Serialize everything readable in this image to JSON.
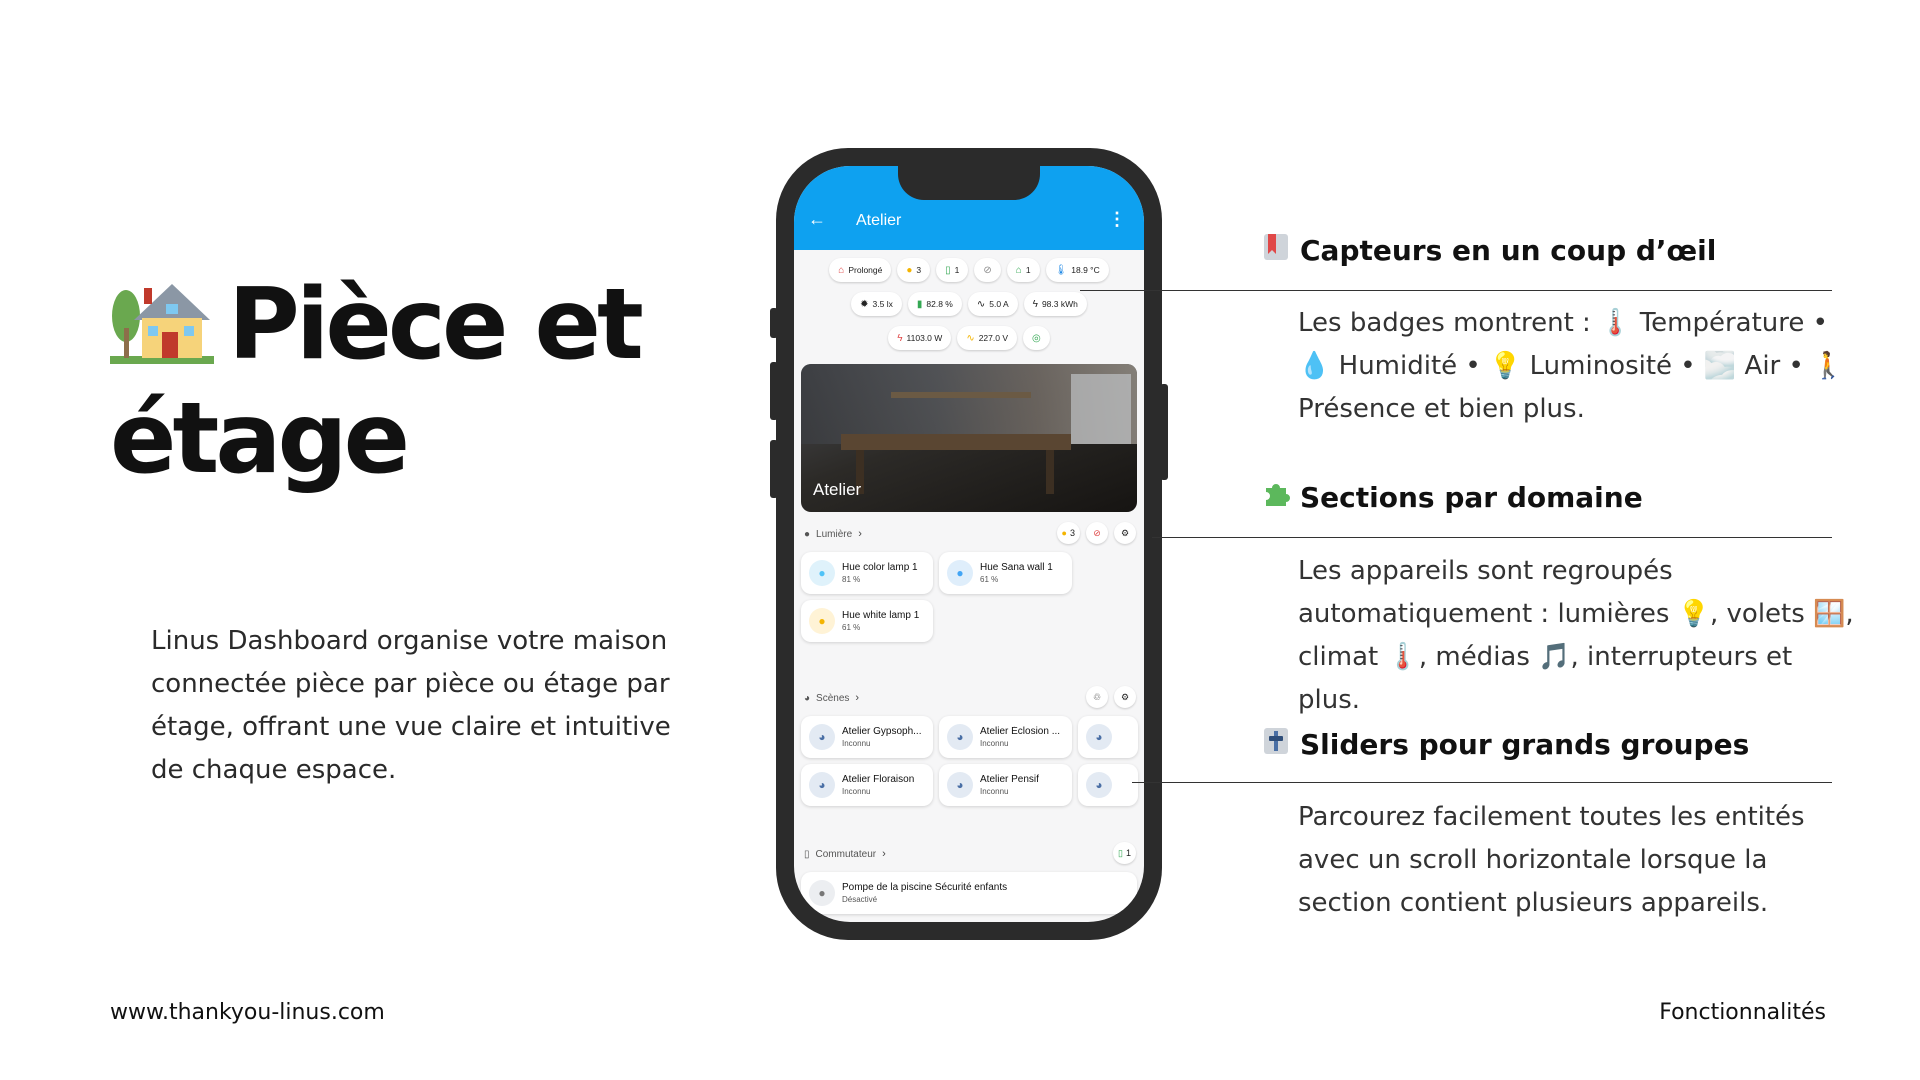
{
  "slide": {
    "title_line1": "Pièce et",
    "title_line2": "étage",
    "intro": "Linus Dashboard organise votre maison connectée pièce par pièce ou étage par étage, offrant une vue claire et intuitive de chaque espace.",
    "footer_left": "www.thankyou-linus.com",
    "footer_right": "Fonctionnalités"
  },
  "phone": {
    "app_title": "Atelier",
    "badges_row1": [
      {
        "icon": "home-icon",
        "label": "Prolongé"
      },
      {
        "icon": "bulb-icon",
        "label": "3"
      },
      {
        "icon": "switch-icon",
        "label": "1"
      },
      {
        "icon": "sensor-off-icon",
        "label": ""
      },
      {
        "icon": "home-green-icon",
        "label": "1"
      },
      {
        "icon": "thermometer-icon",
        "label": "18.9 °C"
      }
    ],
    "badges_row2": [
      {
        "icon": "lux-icon",
        "label": "3.5 lx"
      },
      {
        "icon": "battery-icon",
        "label": "82.8 %"
      },
      {
        "icon": "current-icon",
        "label": "5.0 A"
      },
      {
        "icon": "energy-icon",
        "label": "98.3 kWh"
      }
    ],
    "badges_row3": [
      {
        "icon": "power-icon",
        "label": "1103.0 W"
      },
      {
        "icon": "voltage-icon",
        "label": "227.0 V"
      },
      {
        "icon": "presence-icon",
        "label": ""
      }
    ],
    "room_label": "Atelier",
    "lights": {
      "heading": "Lumière",
      "count": "3",
      "cards": [
        {
          "name": "Hue color lamp 1",
          "state": "81 %"
        },
        {
          "name": "Hue Sana wall 1",
          "state": "61 %"
        },
        {
          "name": "Hue white lamp 1",
          "state": "61 %"
        }
      ]
    },
    "scenes": {
      "heading": "Scènes",
      "cards": [
        {
          "name": "Atelier Gypsoph...",
          "state": "Inconnu"
        },
        {
          "name": "Atelier Éclosion ...",
          "state": "Inconnu"
        },
        {
          "name": "Atelier Floraison",
          "state": "Inconnu"
        },
        {
          "name": "Atelier Pensif",
          "state": "Inconnu"
        }
      ]
    },
    "switches": {
      "heading": "Commutateur",
      "count": "1",
      "cards": [
        {
          "name": "Pompe de la piscine Sécurité enfants",
          "state": "Désactivé"
        }
      ]
    }
  },
  "features": [
    {
      "title": "Capteurs en un coup d’œil",
      "body": "Les badges montrent : 🌡️ Température • 💧 Humidité • 💡 Luminosité • 🌫️ Air • 🚶 Présence et bien plus."
    },
    {
      "title": "Sections par domaine",
      "body": "Les appareils sont regroupés automatiquement : lumières 💡, volets 🪟, climat 🌡️, médias 🎵, interrupteurs et plus."
    },
    {
      "title": "Sliders pour grands groupes",
      "body": "Parcourez facilement toutes les entités avec un scroll horizontale lorsque la section contient plusieurs appareils."
    }
  ]
}
